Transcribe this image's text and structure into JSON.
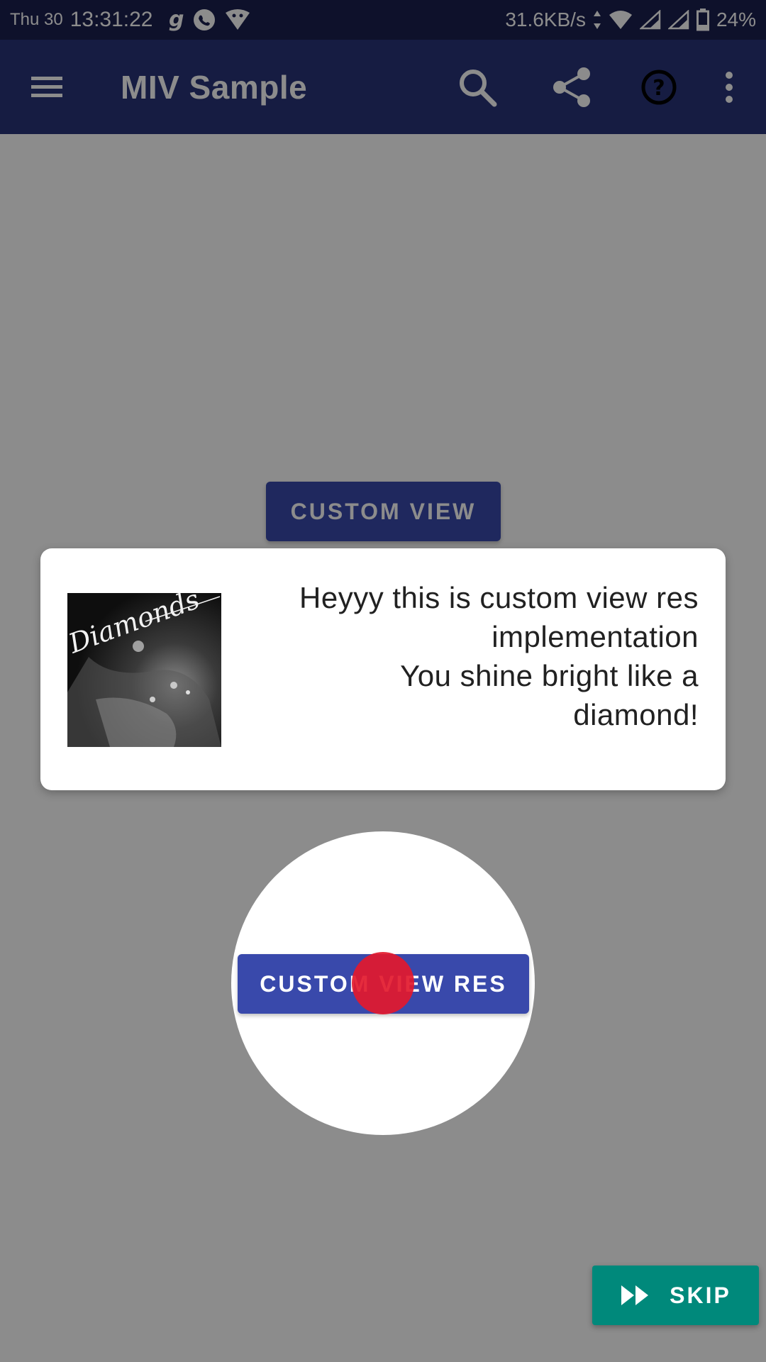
{
  "status_bar": {
    "date": "Thu 30",
    "time": "13:31:22",
    "speed": "31.6KB/s",
    "battery": "24%",
    "icons": [
      "g-app-icon",
      "whatsapp-icon",
      "vpn-icon",
      "data-arrows-icon",
      "wifi-icon",
      "signal-icon",
      "signal-icon",
      "battery-icon"
    ]
  },
  "app_bar": {
    "title": "MIV Sample",
    "icons": [
      "menu-icon",
      "search-icon",
      "share-icon",
      "help-icon",
      "more-vert-icon"
    ],
    "color": "#283479"
  },
  "main": {
    "custom_view_button": "CUSTOM VIEW",
    "custom_view_res_button": "CUSTOM VIEW RES"
  },
  "intro_card": {
    "text_line1": "Heyyy this is custom view res",
    "text_line2": "implementation",
    "text_line3": "You shine bright like a",
    "text_line4": "diamond!",
    "image_caption": "Diamonds"
  },
  "skip": {
    "label": "SKIP",
    "color": "#00897b"
  },
  "colors": {
    "accent": "#3949ab",
    "tap_dot": "#e3192d",
    "status_bar": "#1b1f4f"
  }
}
